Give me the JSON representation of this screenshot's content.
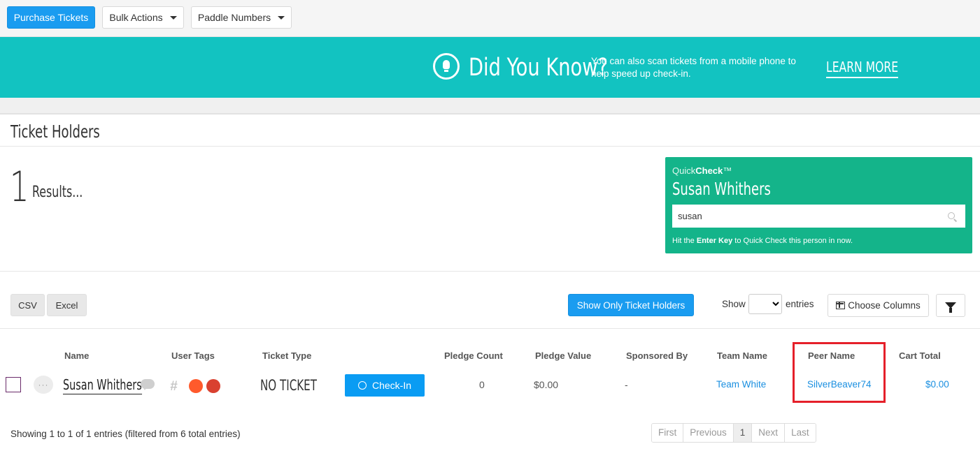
{
  "toolbar": {
    "purchase_label": "Purchase Tickets",
    "bulk_label": "Bulk Actions",
    "paddle_label": "Paddle Numbers"
  },
  "banner": {
    "icon": "lightbulb-icon",
    "headline": "Did You Know?",
    "text": "You can also scan tickets from a mobile phone to help speed up check-in.",
    "link": "LEARN MORE",
    "color": "#12c3c1"
  },
  "section": {
    "title": "Ticket Holders",
    "count": "1",
    "results_label": "Results..."
  },
  "quickcheck": {
    "label_prefix": "Quick",
    "label_bold": "Check",
    "label_suffix": "™",
    "person": "Susan Whithers",
    "input_value": "susan",
    "hint_prefix": "Hit the",
    "hint_key": "Enter Key",
    "hint_suffix": "to Quick Check this person in now.",
    "color": "#14b48a"
  },
  "controls": {
    "csv": "CSV",
    "excel": "Excel",
    "show_only": "Show Only Ticket Holders",
    "show": "Show",
    "entries": "entries",
    "choose_columns": "Choose Columns"
  },
  "table": {
    "headers": {
      "name": "Name",
      "tags": "User Tags",
      "ticket_type": "Ticket Type",
      "pledge_count": "Pledge Count",
      "pledge_value": "Pledge Value",
      "sponsored_by": "Sponsored By",
      "team_name": "Team Name",
      "peer_name": "Peer Name",
      "cart_total": "Cart Total"
    },
    "row": {
      "name": "Susan Whithers",
      "dots": "···",
      "ticket_type": "NO TICKET",
      "checkin": "Check-In",
      "pledge_count": "0",
      "pledge_value": "$0.00",
      "sponsored_by": "-",
      "team_name": "Team White",
      "peer_name": "SilverBeaver74",
      "cart_total": "$0.00",
      "tag_colors": [
        "#ff5a2c",
        "#d94130"
      ]
    }
  },
  "footer": {
    "showing": "Showing 1 to 1 of 1 entries (filtered from 6 total entries)",
    "pager": {
      "first": "First",
      "previous": "Previous",
      "page": "1",
      "next": "Next",
      "last": "Last"
    }
  }
}
